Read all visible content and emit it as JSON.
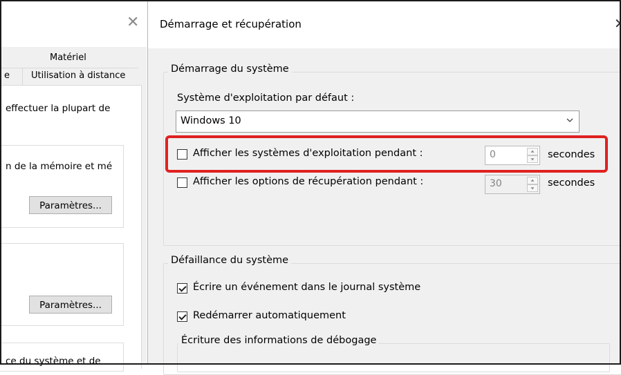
{
  "left_window": {
    "tab_hardware": "Matériel",
    "tab_partial": "e",
    "tab_remote": "Utilisation à distance",
    "text_performance": "effectuer la plupart de",
    "text_memory": "n de la mémoire et mé",
    "text_startup": "ce du système et de",
    "button_settings_1": "Paramètres...",
    "button_settings_2": "Paramètres..."
  },
  "dialog": {
    "title": "Démarrage et récupération",
    "system_startup": {
      "legend": "Démarrage du système",
      "default_os_label": "Système d'exploitation par défaut :",
      "default_os_value": "Windows 10",
      "show_os_list": {
        "label": "Afficher les systèmes d'exploitation pendant :",
        "checked": false,
        "value": "0",
        "unit": "secondes"
      },
      "show_recovery": {
        "label": "Afficher les options de récupération pendant :",
        "checked": false,
        "value": "30",
        "unit": "secondes"
      }
    },
    "system_failure": {
      "legend": "Défaillance du système",
      "write_event": {
        "label": "Écrire un événement dans le journal système",
        "checked": true
      },
      "auto_restart": {
        "label": "Redémarrer automatiquement",
        "checked": true
      },
      "debug_info_legend": "Écriture des informations de débogage"
    }
  },
  "colors": {
    "highlight": "#e02020",
    "dialog_bg": "#f0f0f0"
  }
}
